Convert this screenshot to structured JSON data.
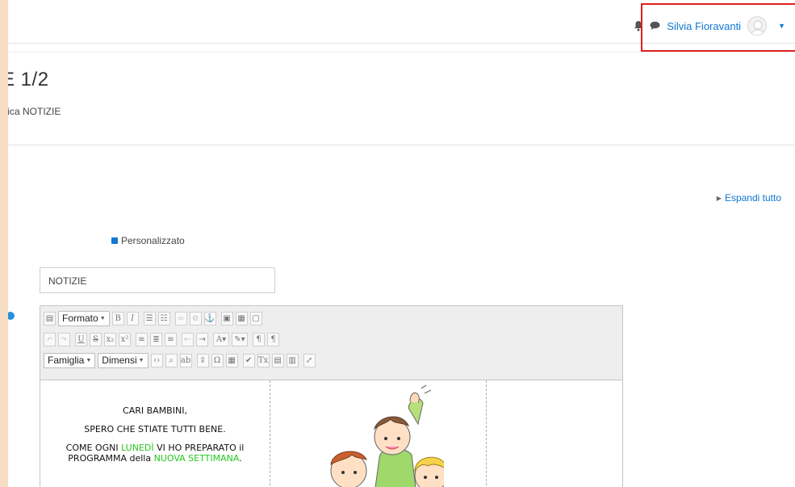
{
  "navbar": {
    "user_name": "Silvia Fioravanti",
    "icons": [
      "bell-icon",
      "chat-icon",
      "avatar",
      "chevron-down-icon"
    ]
  },
  "header": {
    "title": "E 1/2",
    "breadcrumb": "fica NOTIZIE"
  },
  "main": {
    "expand_all": "Espandi tutto",
    "custom_label": "Personalizzato",
    "name_input_value": "NOTIZIE"
  },
  "editor": {
    "format_label": "Formato",
    "family_label": "Famiglia",
    "size_label": "Dimensi",
    "content": {
      "line1": "CARI BAMBINI,",
      "line2": "SPERO CHE STIATE TUTTI BENE.",
      "line3_a": "COME OGNI ",
      "line3_b": "LUNEDÌ",
      "line3_c": " VI HO PREPARATO il",
      "line4_a": "PROGRAMMA della ",
      "line4_b": "NUOVA SETTIMANA",
      "line4_c": "."
    }
  },
  "colors": {
    "link": "#1177d1",
    "highlight": "#e02020",
    "green_text": "#27c71f",
    "outer_bg": "#f7dcc4"
  }
}
